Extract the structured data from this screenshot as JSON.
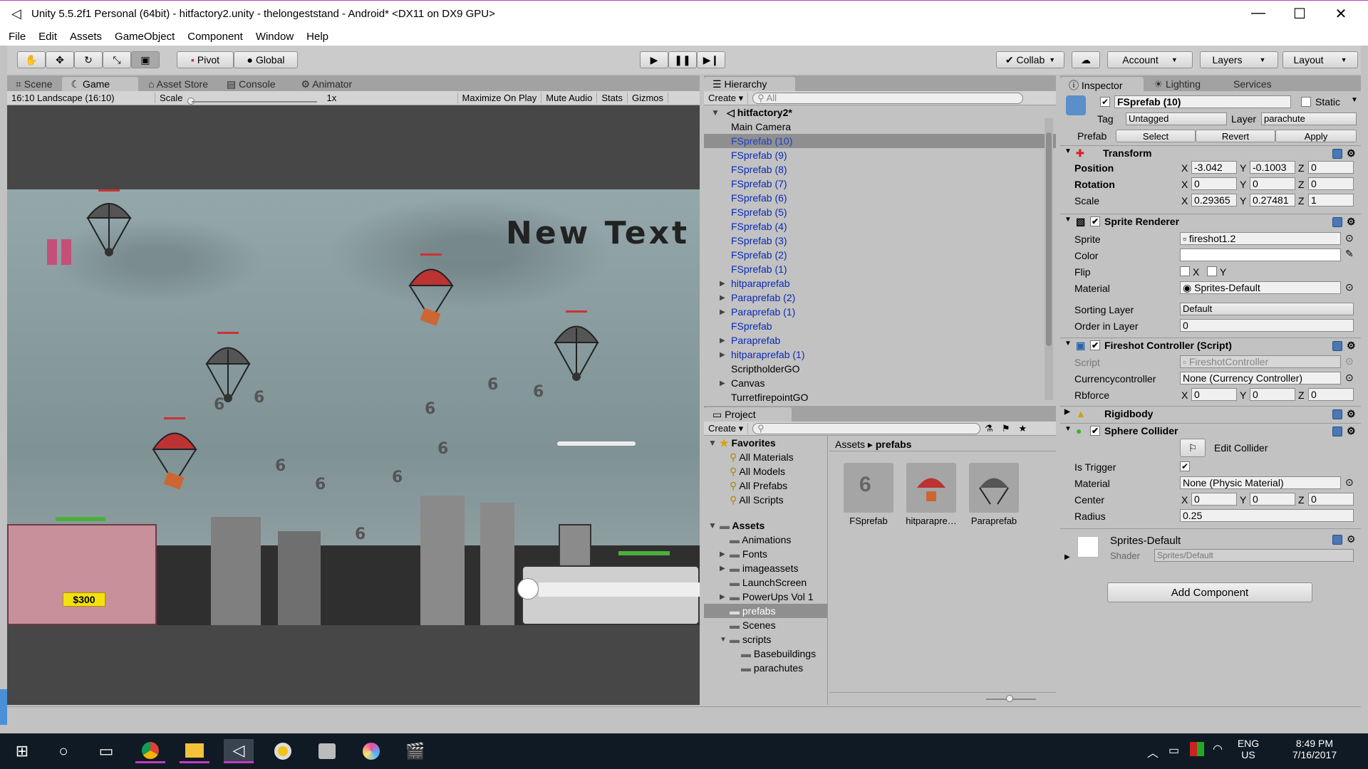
{
  "window": {
    "title": "Unity 5.5.2f1 Personal (64bit) - hitfactory2.unity - thelongeststand - Android* <DX11 on DX9 GPU>",
    "controls": [
      "—",
      "☐",
      "✕"
    ]
  },
  "menu": [
    "File",
    "Edit",
    "Assets",
    "GameObject",
    "Component",
    "Window",
    "Help"
  ],
  "toolbar": {
    "pivot": "Pivot",
    "global": "Global",
    "collab": "Collab",
    "account": "Account",
    "layers": "Layers",
    "layout": "Layout"
  },
  "game_panel": {
    "tabs": [
      "Scene",
      "Game",
      "Asset Store",
      "Console",
      "Animator"
    ],
    "active_tab": "Game",
    "aspect": "16:10 Landscape (16:10)",
    "scale_label": "Scale",
    "scale_value": "1x",
    "buttons": [
      "Maximize On Play",
      "Mute Audio",
      "Stats",
      "Gizmos"
    ],
    "scene": {
      "overlay_text": "New Text",
      "money": "$300",
      "numbers": [
        "6",
        "6",
        "6",
        "6",
        "6",
        "6",
        "6",
        "6",
        "6",
        "6",
        "6",
        "6",
        "6",
        "6"
      ]
    }
  },
  "hierarchy": {
    "tab": "Hierarchy",
    "create": "Create",
    "search_placeholder": "All",
    "scene_name": "hitfactory2*",
    "items": [
      {
        "label": "Main Camera",
        "type": "object"
      },
      {
        "label": "FSprefab (10)",
        "type": "prefab",
        "selected": true
      },
      {
        "label": "FSprefab (9)",
        "type": "prefab"
      },
      {
        "label": "FSprefab (8)",
        "type": "prefab"
      },
      {
        "label": "FSprefab (7)",
        "type": "prefab"
      },
      {
        "label": "FSprefab (6)",
        "type": "prefab"
      },
      {
        "label": "FSprefab (5)",
        "type": "prefab"
      },
      {
        "label": "FSprefab (4)",
        "type": "prefab"
      },
      {
        "label": "FSprefab (3)",
        "type": "prefab"
      },
      {
        "label": "FSprefab (2)",
        "type": "prefab"
      },
      {
        "label": "FSprefab (1)",
        "type": "prefab"
      },
      {
        "label": "hitparaprefab",
        "type": "prefab",
        "expandable": true
      },
      {
        "label": "Paraprefab (2)",
        "type": "prefab",
        "expandable": true
      },
      {
        "label": "Paraprefab (1)",
        "type": "prefab",
        "expandable": true
      },
      {
        "label": "FSprefab",
        "type": "prefab"
      },
      {
        "label": "Paraprefab",
        "type": "prefab",
        "expandable": true
      },
      {
        "label": "hitparaprefab (1)",
        "type": "prefab",
        "expandable": true
      },
      {
        "label": "ScriptholderGO",
        "type": "object"
      },
      {
        "label": "Canvas",
        "type": "object",
        "expandable": true
      },
      {
        "label": "TurretfirepointGO",
        "type": "object"
      }
    ]
  },
  "project": {
    "tab": "Project",
    "create": "Create",
    "favorites_label": "Favorites",
    "favorites": [
      "All Materials",
      "All Models",
      "All Prefabs",
      "All Scripts"
    ],
    "assets_label": "Assets",
    "folders": [
      {
        "label": "Animations"
      },
      {
        "label": "Fonts",
        "expandable": true
      },
      {
        "label": "imageassets",
        "expandable": true
      },
      {
        "label": "LaunchScreen"
      },
      {
        "label": "PowerUps Vol 1",
        "expandable": true
      },
      {
        "label": "prefabs",
        "selected": true
      },
      {
        "label": "Scenes"
      },
      {
        "label": "scripts",
        "expanded": true
      }
    ],
    "subfolders": [
      "Basebuildings",
      "parachutes"
    ],
    "breadcrumb": [
      "Assets",
      "prefabs"
    ],
    "assets": [
      "FSprefab",
      "hitparapre…",
      "Paraprefab"
    ]
  },
  "inspector": {
    "tabs": [
      "Inspector",
      "Lighting",
      "Services"
    ],
    "object_name": "FSprefab (10)",
    "static_label": "Static",
    "tag_label": "Tag",
    "tag_value": "Untagged",
    "layer_label": "Layer",
    "layer_value": "parachute",
    "prefab_label": "Prefab",
    "prefab_buttons": [
      "Select",
      "Revert",
      "Apply"
    ],
    "transform": {
      "title": "Transform",
      "position_label": "Position",
      "rotation_label": "Rotation",
      "scale_label": "Scale",
      "position": {
        "x": "-3.042",
        "y": "-0.1003",
        "z": "0"
      },
      "rotation": {
        "x": "0",
        "y": "0",
        "z": "0"
      },
      "scale": {
        "x": "0.29365",
        "y": "0.27481",
        "z": "1"
      }
    },
    "sprite_renderer": {
      "title": "Sprite Renderer",
      "sprite_label": "Sprite",
      "sprite_value": "fireshot1.2",
      "color_label": "Color",
      "flip_label": "Flip",
      "flip_x": "X",
      "flip_y": "Y",
      "material_label": "Material",
      "material_value": "Sprites-Default",
      "sorting_layer_label": "Sorting Layer",
      "sorting_layer_value": "Default",
      "order_label": "Order in Layer",
      "order_value": "0"
    },
    "fireshot": {
      "title": "Fireshot Controller (Script)",
      "script_label": "Script",
      "script_value": "FireshotController",
      "currency_label": "Currencycontroller",
      "currency_value": "None (Currency Controller)",
      "rbforce_label": "Rbforce",
      "rbforce": {
        "x": "0",
        "y": "0",
        "z": "0"
      }
    },
    "rigidbody_title": "Rigidbody",
    "sphere_collider": {
      "title": "Sphere Collider",
      "edit_label": "Edit Collider",
      "is_trigger_label": "Is Trigger",
      "material_label": "Material",
      "material_value": "None (Physic Material)",
      "center_label": "Center",
      "center": {
        "x": "0",
        "y": "0",
        "z": "0"
      },
      "radius_label": "Radius",
      "radius_value": "0.25"
    },
    "material_block": {
      "name": "Sprites-Default",
      "shader_label": "Shader",
      "shader_value": "Sprites/Default"
    },
    "add_component": "Add Component"
  },
  "taskbar": {
    "lang": "ENG",
    "region": "US",
    "time": "8:49 PM",
    "date": "7/16/2017",
    "icons": [
      "windows-icon",
      "cortana-icon",
      "task-view-icon",
      "chrome-icon",
      "file-explorer-icon",
      "unity-icon",
      "disc-icon",
      "app-icon",
      "paint-icon",
      "clapper-icon"
    ]
  },
  "colors": {
    "prefab_blue": "#0b2ab3",
    "selection": "#8f8f8f",
    "editor_bg": "#c2c2c2",
    "taskbar": "#101a24"
  }
}
